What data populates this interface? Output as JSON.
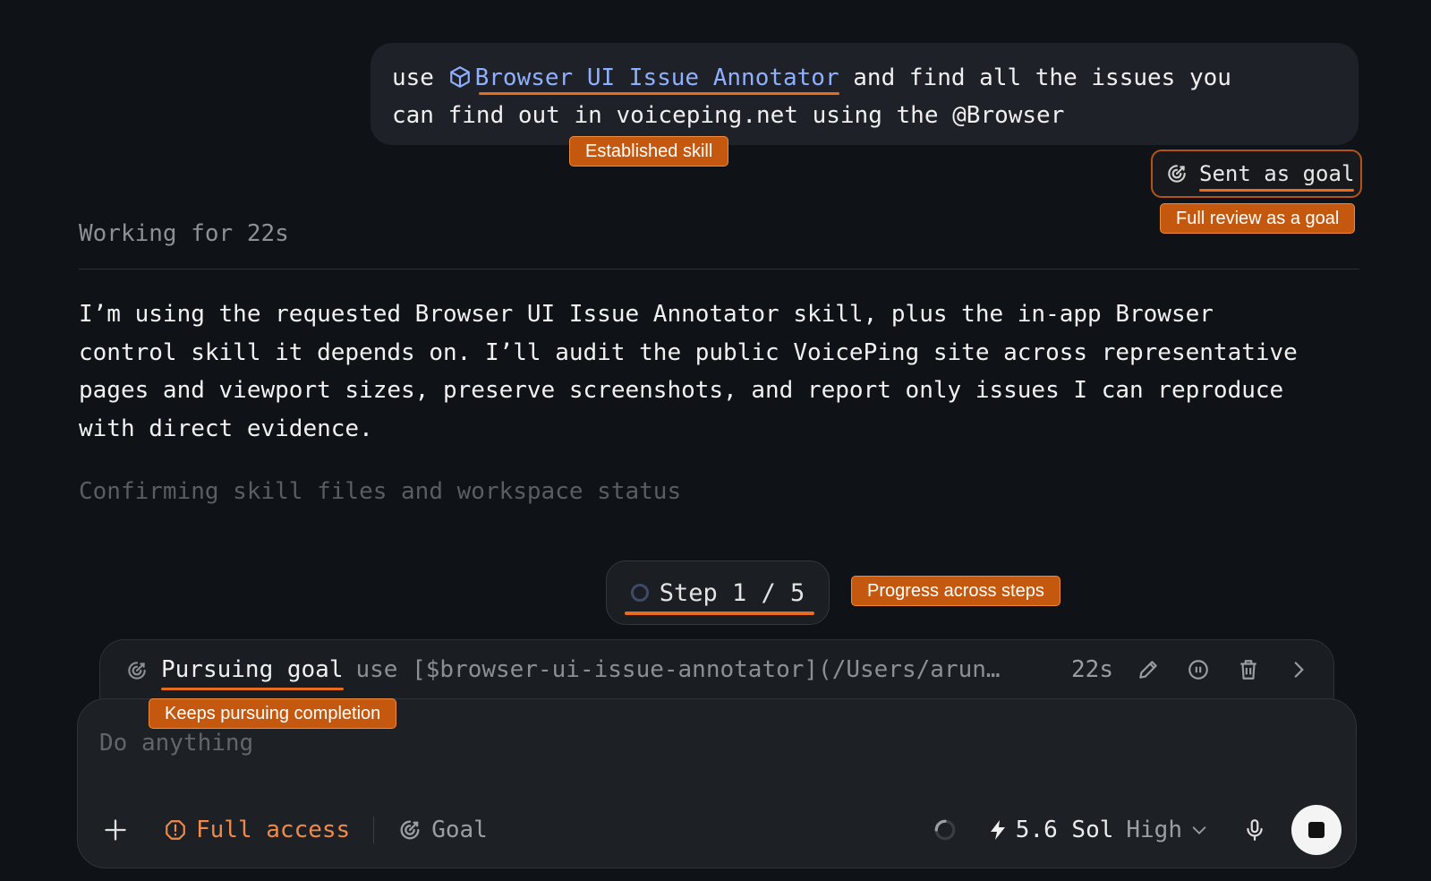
{
  "message": {
    "prefix": "use",
    "skill_name": "Browser UI Issue Annotator",
    "suffix": "and find all the issues you",
    "line2": "can find out in voiceping.net using the @Browser"
  },
  "sent_badge": {
    "label": "Sent as goal"
  },
  "annotations": {
    "established_skill": "Established skill",
    "full_review": "Full review as a goal",
    "progress": "Progress across steps",
    "keeps_pursuing": "Keeps pursuing completion"
  },
  "working": "Working for 22s",
  "reply": {
    "line1": "I’m using the requested Browser UI Issue Annotator skill, plus the in-app Browser",
    "line2": "control skill it depends on. I’ll audit the public VoicePing site across representative",
    "line3": "pages and viewport sizes, preserve screenshots, and report only issues I can reproduce",
    "line4": "with direct evidence."
  },
  "status_line": "Confirming skill files and workspace status",
  "step": {
    "label": "Step 1 / 5"
  },
  "goal_bar": {
    "label": "Pursuing goal",
    "text": "use [$browser-ui-issue-annotator](/Users/arun…",
    "elapsed": "22s"
  },
  "composer": {
    "placeholder": "Do anything",
    "access": "Full access",
    "goal": "Goal",
    "model": "5.6 Sol",
    "effort": "High"
  },
  "colors": {
    "accent": "#e96b1d",
    "tag_bg": "#c4580f",
    "skill_link": "#8fb0ff",
    "bg": "#0f1216"
  }
}
